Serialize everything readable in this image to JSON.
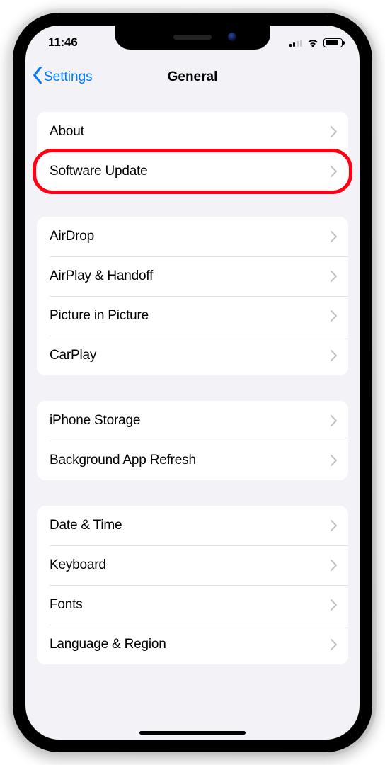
{
  "status": {
    "time": "11:46"
  },
  "nav": {
    "back_label": "Settings",
    "title": "General"
  },
  "groups": [
    {
      "rows": [
        {
          "key": "about",
          "label": "About"
        },
        {
          "key": "software-update",
          "label": "Software Update",
          "highlight": true
        }
      ]
    },
    {
      "rows": [
        {
          "key": "airdrop",
          "label": "AirDrop"
        },
        {
          "key": "airplay-handoff",
          "label": "AirPlay & Handoff"
        },
        {
          "key": "picture-in-picture",
          "label": "Picture in Picture"
        },
        {
          "key": "carplay",
          "label": "CarPlay"
        }
      ]
    },
    {
      "rows": [
        {
          "key": "iphone-storage",
          "label": "iPhone Storage"
        },
        {
          "key": "background-app-refresh",
          "label": "Background App Refresh"
        }
      ]
    },
    {
      "rows": [
        {
          "key": "date-time",
          "label": "Date & Time"
        },
        {
          "key": "keyboard",
          "label": "Keyboard"
        },
        {
          "key": "fonts",
          "label": "Fonts"
        },
        {
          "key": "language-region",
          "label": "Language & Region"
        }
      ]
    }
  ],
  "colors": {
    "accent": "#007aff",
    "highlight": "#ff0014",
    "bg": "#f2f2f7"
  }
}
